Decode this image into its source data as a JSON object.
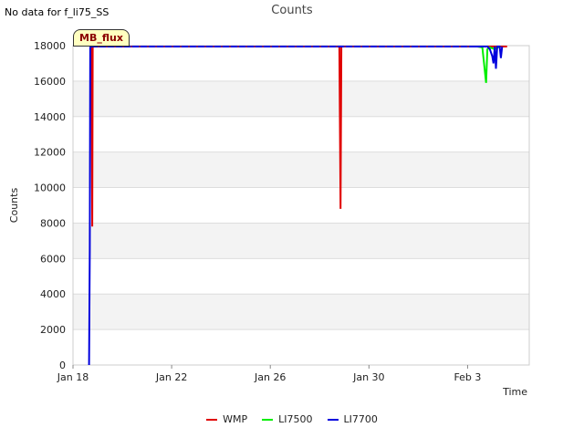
{
  "no_data_text": "No data for f_li75_SS",
  "badge": "MB_flux",
  "chart_data": {
    "type": "line",
    "title": "Counts",
    "xlabel": "Time",
    "ylabel": "Counts",
    "ylim": [
      0,
      18000
    ],
    "yticks": [
      0,
      2000,
      4000,
      6000,
      8000,
      10000,
      12000,
      14000,
      16000,
      18000
    ],
    "xlim": [
      0,
      18.5
    ],
    "xticks": [
      {
        "label": "Jan 18",
        "value": 0
      },
      {
        "label": "Jan 22",
        "value": 4
      },
      {
        "label": "Jan 26",
        "value": 8
      },
      {
        "label": "Jan 30",
        "value": 12
      },
      {
        "label": "Feb 3",
        "value": 16
      }
    ],
    "grid": true,
    "legend_position": "bottom",
    "series": [
      {
        "name": "WMP",
        "color": "#e00000",
        "x": [
          0.7,
          0.75,
          0.78,
          0.8,
          0.83,
          0.88,
          0.95,
          10.8,
          10.85,
          10.88,
          10.92,
          17.6
        ],
        "y": [
          17950,
          17900,
          7800,
          17900,
          17950,
          17950,
          17950,
          17950,
          8800,
          17950,
          17950,
          17950
        ]
      },
      {
        "name": "LI7500",
        "color": "#00ee00",
        "x": [
          16.4,
          16.6,
          16.75,
          16.8,
          16.9,
          17.1,
          17.3
        ],
        "y": [
          17950,
          17900,
          15900,
          17800,
          17900,
          17800,
          17950
        ]
      },
      {
        "name": "LI7700",
        "color": "#0000dd",
        "x": [
          0.65,
          0.68,
          0.7,
          0.72,
          0.74,
          0.78,
          16.8,
          16.9,
          17.0,
          17.05,
          17.1,
          17.15,
          17.2,
          17.3,
          17.35,
          17.4
        ],
        "y": [
          0,
          6500,
          17900,
          17950,
          17950,
          17950,
          17950,
          17800,
          17400,
          17000,
          17950,
          16700,
          17950,
          17950,
          17300,
          17950
        ]
      }
    ]
  }
}
